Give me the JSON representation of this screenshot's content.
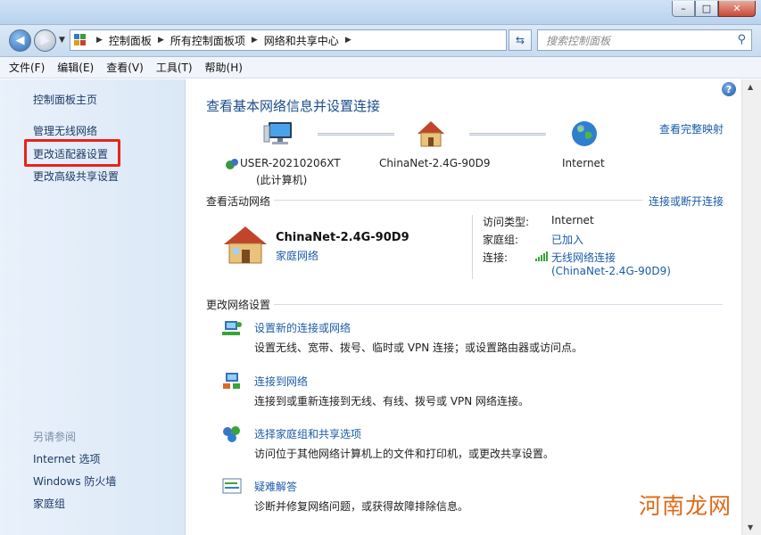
{
  "window": {
    "controls": [
      "–",
      "□",
      "✕"
    ]
  },
  "address": {
    "crumbs": [
      "控制面板",
      "所有控制面板项",
      "网络和共享中心"
    ],
    "search_placeholder": "搜索控制面板"
  },
  "menu": [
    "文件(F)",
    "编辑(E)",
    "查看(V)",
    "工具(T)",
    "帮助(H)"
  ],
  "sidebar": {
    "links": [
      "控制面板主页",
      "管理无线网络",
      "更改适配器设置",
      "更改高级共享设置"
    ],
    "see_also_heading": "另请参阅",
    "see_also": [
      "Internet 选项",
      "Windows 防火墙",
      "家庭组"
    ]
  },
  "main": {
    "title": "查看基本网络信息并设置连接",
    "full_map_link": "查看完整映射",
    "nodes": {
      "computer_line1": "USER-20210206XT",
      "computer_line2": "(此计算机)",
      "network": "ChinaNet-2.4G-90D9",
      "internet": "Internet"
    },
    "active": {
      "section_title": "查看活动网络",
      "connect_link": "连接或断开连接",
      "network_name": "ChinaNet-2.4G-90D9",
      "network_type": "家庭网络",
      "access_type_label": "访问类型:",
      "access_type_value": "Internet",
      "homegroup_label": "家庭组:",
      "homegroup_value": "已加入",
      "connection_label": "连接:",
      "connection_value_line1": "无线网络连接",
      "connection_value_line2": "(ChinaNet-2.4G-90D9)"
    },
    "change": {
      "section_title": "更改网络设置",
      "tasks": [
        {
          "link": "设置新的连接或网络",
          "desc": "设置无线、宽带、拨号、临时或 VPN 连接；或设置路由器或访问点。"
        },
        {
          "link": "连接到网络",
          "desc": "连接到或重新连接到无线、有线、拨号或 VPN 网络连接。"
        },
        {
          "link": "选择家庭组和共享选项",
          "desc": "访问位于其他网络计算机上的文件和打印机，或更改共享设置。"
        },
        {
          "link": "疑难解答",
          "desc": "诊断并修复网络问题，或获得故障排除信息。"
        }
      ]
    }
  },
  "watermark": "河南龙网",
  "colors": {
    "link": "#1b5ca8",
    "title": "#1b4e8c",
    "highlight": "#e8231c"
  }
}
